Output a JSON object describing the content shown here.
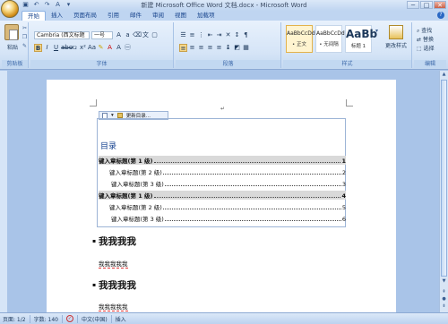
{
  "window": {
    "title": "新建 Microsoft Office Word 文档.docx - Microsoft Word",
    "min": "─",
    "max": "□",
    "close": "✕"
  },
  "tabs": [
    "开始",
    "插入",
    "页面布局",
    "引用",
    "邮件",
    "审阅",
    "视图",
    "加载项"
  ],
  "ribbon": {
    "clipboard": {
      "paste_label": "粘贴",
      "group_label": "剪贴板"
    },
    "font": {
      "family": "Cambria (西文标题",
      "size": "一号",
      "group_label": "字体"
    },
    "paragraph": {
      "group_label": "段落"
    },
    "styles": {
      "items": [
        {
          "sample": "AaBbCcDd",
          "name": "• 正文"
        },
        {
          "sample": "AaBbCcDd",
          "name": "• 无间隔"
        },
        {
          "sample": "AaBb",
          "name": "标题 1"
        }
      ],
      "change_styles": "更改样式",
      "group_label": "样式"
    },
    "editing": {
      "find": "查找",
      "replace": "替换",
      "select": "选择",
      "group_label": "编辑"
    }
  },
  "toc": {
    "toolbar_update": "更新目录...",
    "title": "目录",
    "entries": [
      {
        "text": "键入章标题(第 1 级)",
        "page": "1",
        "level": 1
      },
      {
        "text": "键入章标题(第 2 级)",
        "page": "2",
        "level": 2
      },
      {
        "text": "键入章标题(第 3 级)",
        "page": "3",
        "level": 3
      },
      {
        "text": "键入章标题(第 1 级)",
        "page": "4",
        "level": 1
      },
      {
        "text": "键入章标题(第 2 级)",
        "page": "5",
        "level": 2
      },
      {
        "text": "键入章标题(第 3 级)",
        "page": "6",
        "level": 3
      }
    ]
  },
  "document": {
    "heading1": "我我我我",
    "body1": "我我我我我",
    "heading2": "我我我我",
    "body2": "我我我我我"
  },
  "status": {
    "page": "页面: 1/2",
    "words": "字数: 140",
    "language": "中文(中国)",
    "mode": "插入"
  },
  "colors": {
    "accent": "#15428b",
    "ribbon_bg": "#d6e5f7",
    "workspace": "#a9c4e8"
  }
}
